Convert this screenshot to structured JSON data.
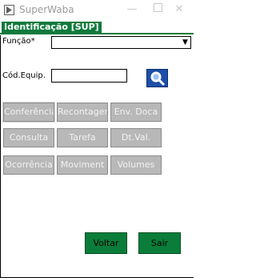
{
  "window": {
    "title": "SuperWaba",
    "minimize_icon": "minimize-icon",
    "maximize_icon": "maximize-icon",
    "close_icon": "close-icon",
    "close_glyph": "✕",
    "minimize_glyph": "—"
  },
  "tab": {
    "label": "Identificação [SUP]",
    "color": "#0e7a3c"
  },
  "form": {
    "funcao_label": "Função*",
    "funcao_value": "",
    "funcao_arrow": "▼",
    "cod_equip_label": "Cód.Equip.",
    "cod_equip_value": "",
    "search_icon": "magnifier-icon"
  },
  "buttons": [
    {
      "label": "Conferência"
    },
    {
      "label": "Recontagem"
    },
    {
      "label": "Env. Doca"
    },
    {
      "label": "Consulta"
    },
    {
      "label": "Tarefa"
    },
    {
      "label": "Dt.Val."
    },
    {
      "label": "Ocorrência"
    },
    {
      "label": "Moviment"
    },
    {
      "label": "Volumes"
    }
  ],
  "actions": {
    "voltar_label": "Voltar",
    "sair_label": "Sair"
  },
  "colors": {
    "accent": "#0e7a3c",
    "action_button": "#0b7d3a",
    "disabled_button": "#b8b8b8",
    "search_button": "#1d4fa8"
  }
}
